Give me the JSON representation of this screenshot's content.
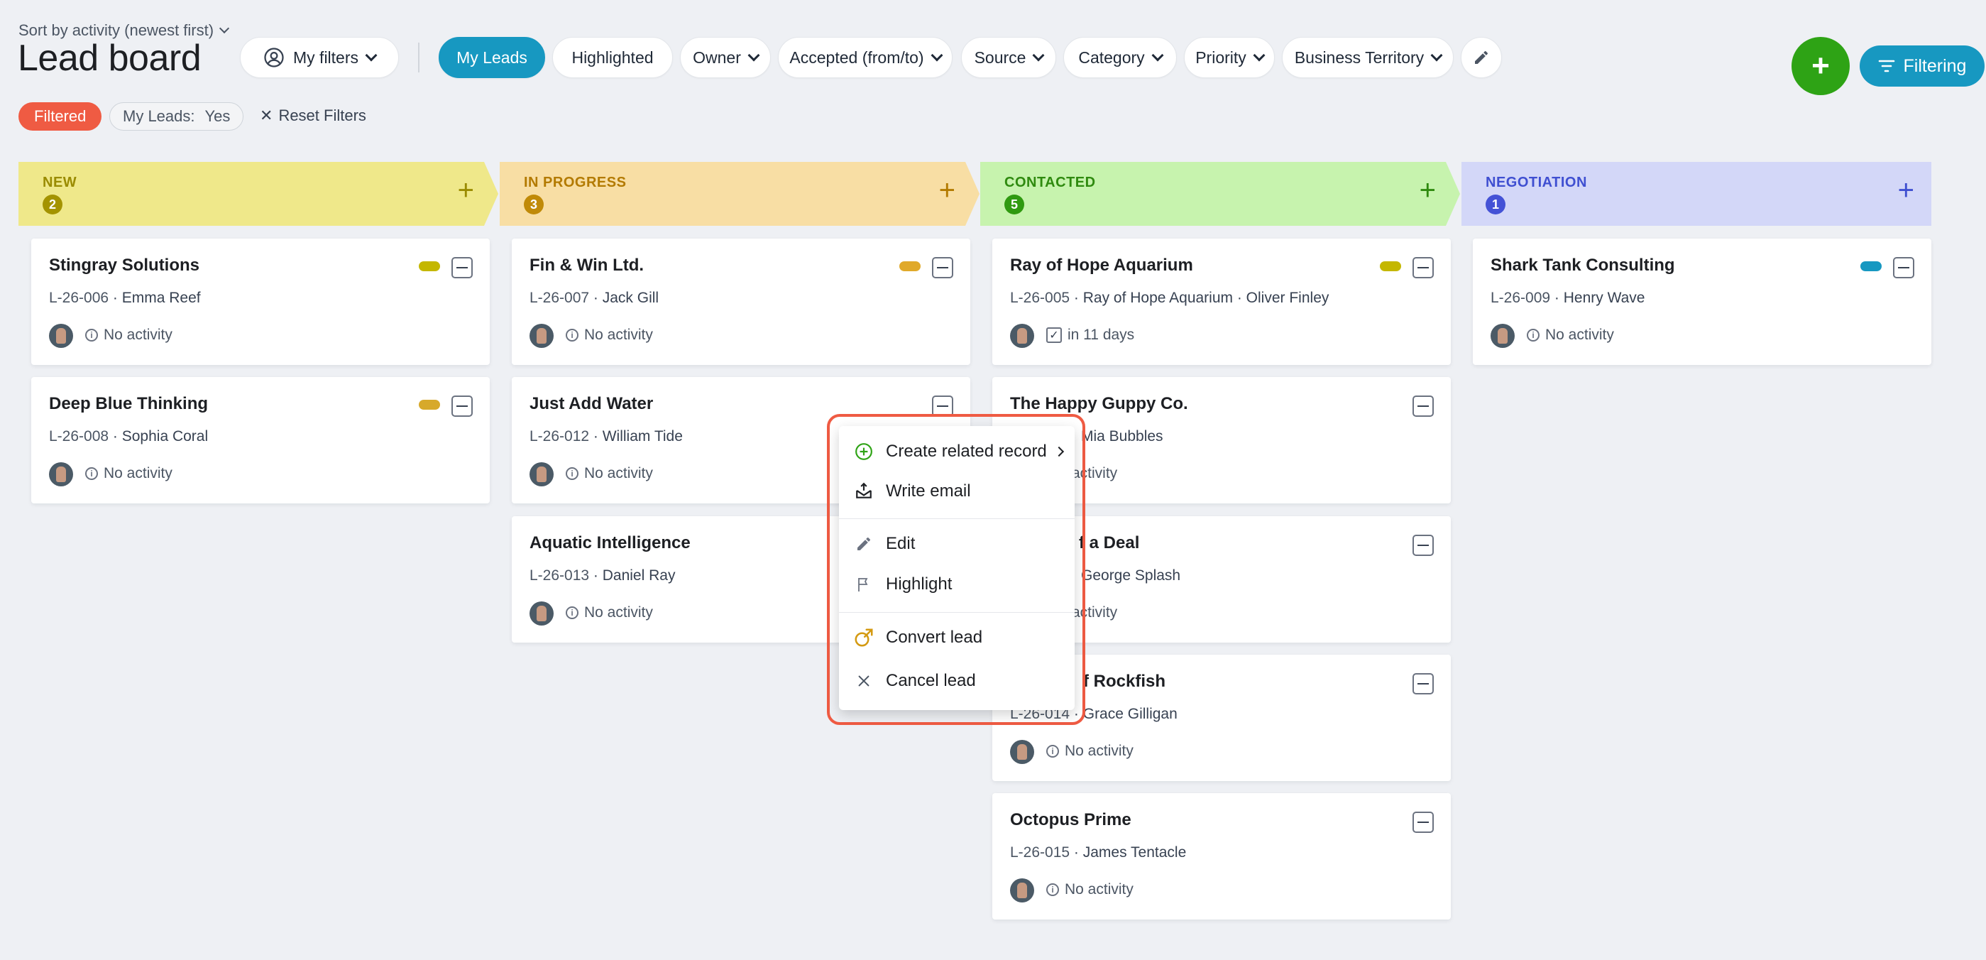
{
  "header": {
    "sort_label": "Sort by activity (newest first)",
    "title": "Lead board",
    "my_filters": "My filters",
    "filters": {
      "my_leads": "My Leads",
      "highlighted": "Highlighted",
      "owner": "Owner",
      "accepted": "Accepted (from/to)",
      "source": "Source",
      "category": "Category",
      "priority": "Priority",
      "business_territory": "Business Territory"
    },
    "add_button": "+",
    "filtering_button": "Filtering"
  },
  "filter_row": {
    "filtered": "Filtered",
    "my_leads_label": "My Leads:",
    "my_leads_value": "Yes",
    "reset": "Reset Filters"
  },
  "colors": {
    "accent": "#1798c1",
    "add": "#2ea315",
    "filtered": "#ef5b43"
  },
  "columns": {
    "new": {
      "name": "NEW",
      "count": "2"
    },
    "in_progress": {
      "name": "IN PROGRESS",
      "count": "3"
    },
    "contacted": {
      "name": "CONTACTED",
      "count": "5"
    },
    "negotiation": {
      "name": "NEGOTIATION",
      "count": "1"
    }
  },
  "cards": {
    "c1": {
      "title": "Stingray Solutions",
      "code": "L-26-006",
      "person": "Emma Reef",
      "activity": "No activity"
    },
    "c2": {
      "title": "Deep Blue Thinking",
      "code": "L-26-008",
      "person": "Sophia Coral",
      "activity": "No activity"
    },
    "c3": {
      "title": "Fin & Win Ltd.",
      "code": "L-26-007",
      "person": "Jack Gill",
      "activity": "No activity"
    },
    "c4": {
      "title": "Just Add Water",
      "code": "L-26-012",
      "person": "William Tide",
      "activity": "No activity"
    },
    "c5": {
      "title": "Aquatic Intelligence",
      "code": "L-26-013",
      "person": "Daniel Ray",
      "activity": "No activity"
    },
    "c6": {
      "title": "Ray of Hope Aquarium",
      "code": "L-26-005",
      "person": "Ray of Hope Aquarium · Oliver Finley",
      "activity": "in 11 days"
    },
    "c7": {
      "title": "The Happy Guppy Co.",
      "person": "Mia Bubbles",
      "activity": "activity"
    },
    "c8": {
      "title": "f a Deal",
      "person": "George Splash",
      "activity": "activity"
    },
    "c9": {
      "title": "f Rockfish",
      "code": "L-26-014",
      "person": "Grace Gilligan",
      "activity": "No activity"
    },
    "c10": {
      "title": "Octopus Prime",
      "code": "L-26-015",
      "person": "James Tentacle",
      "activity": "No activity"
    },
    "c11": {
      "title": "Shark Tank Consulting",
      "code": "L-26-009",
      "person": "Henry Wave",
      "activity": "No activity"
    }
  },
  "context_menu": {
    "create_related": "Create related record",
    "write_email": "Write email",
    "edit": "Edit",
    "highlight": "Highlight",
    "convert_lead": "Convert lead",
    "cancel_lead": "Cancel lead"
  }
}
